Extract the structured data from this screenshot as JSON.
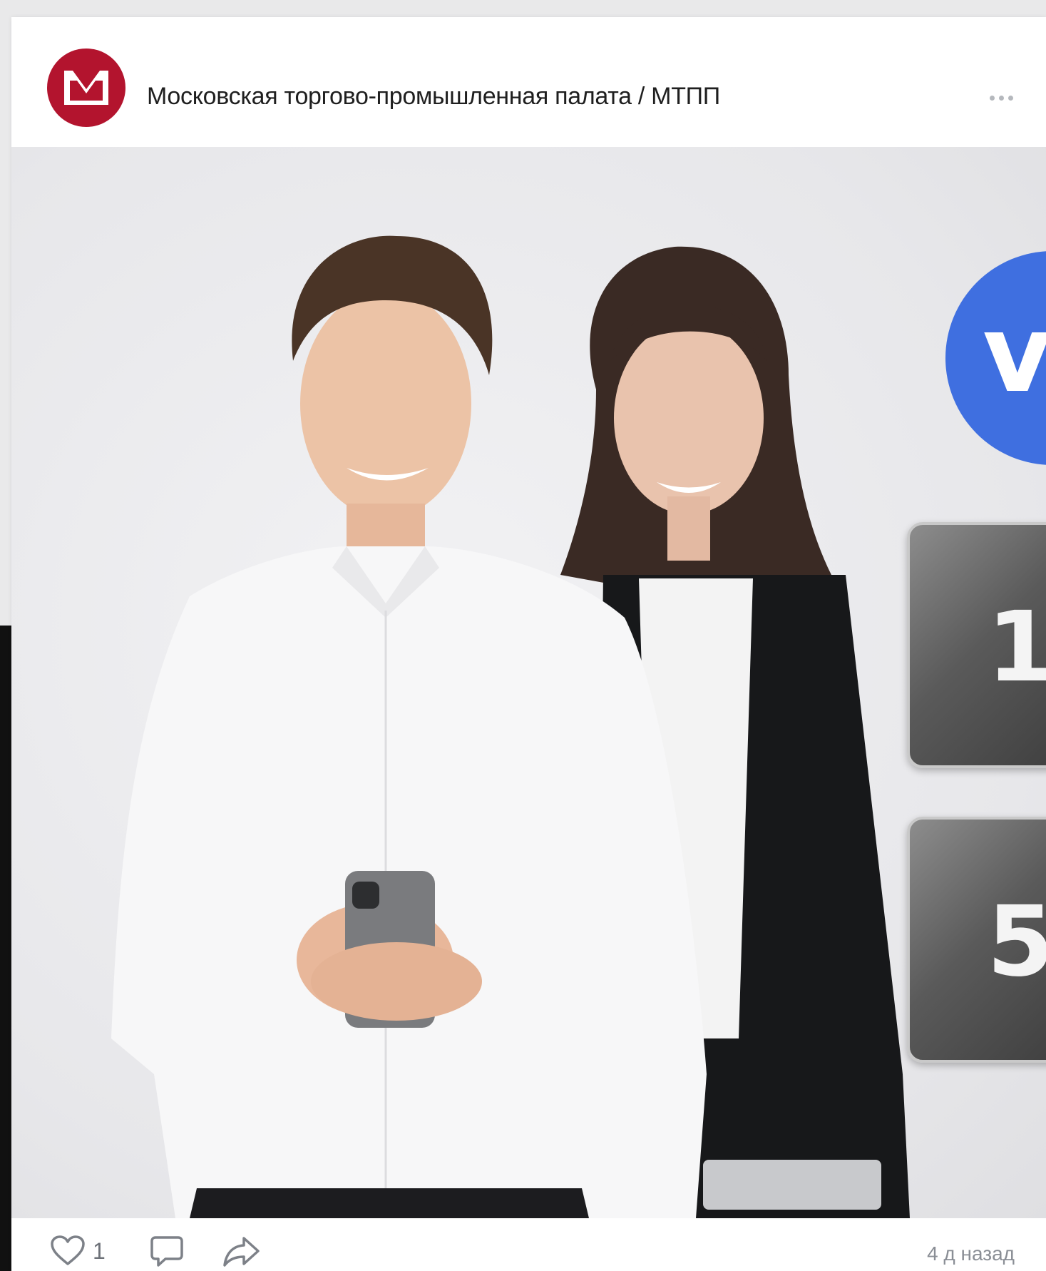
{
  "post": {
    "group_name": "Московская торгово-промышленная палата / МТПП",
    "avatar_letter": "М",
    "more_icon": "more-horizontal-icon"
  },
  "image": {
    "logo_letter": "v",
    "stats": [
      {
        "value": "1"
      },
      {
        "value": "5"
      }
    ]
  },
  "footer": {
    "likes": "1",
    "timestamp": "4 д назад",
    "icons": [
      "heart-icon",
      "comment-icon",
      "share-icon"
    ]
  },
  "colors": {
    "brand_red": "#b3142e",
    "vk_blue": "#3f6fe0",
    "tile_gray": "#5a5a5a",
    "meta_text": "#8a8e95"
  }
}
